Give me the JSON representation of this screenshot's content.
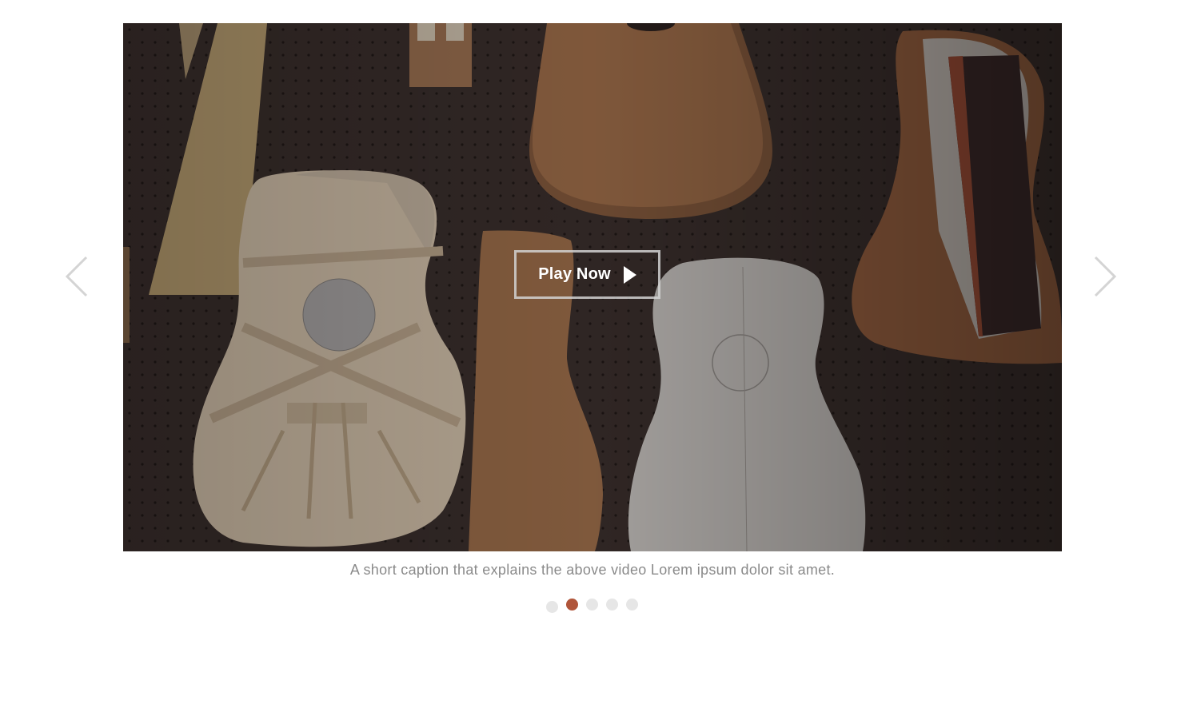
{
  "slide": {
    "play_label": "Play Now",
    "caption": "A short caption that explains the above video Lorem ipsum dolor sit amet."
  },
  "navigation": {
    "prev_icon": "chevron-left-icon",
    "next_icon": "chevron-right-icon"
  },
  "pagination": {
    "total": 5,
    "active_index": 1
  },
  "colors": {
    "accent": "#b0553a",
    "dot_inactive": "#e6e6e6",
    "caption_text": "#8a8a8a",
    "arrow": "#d4d4d4"
  }
}
